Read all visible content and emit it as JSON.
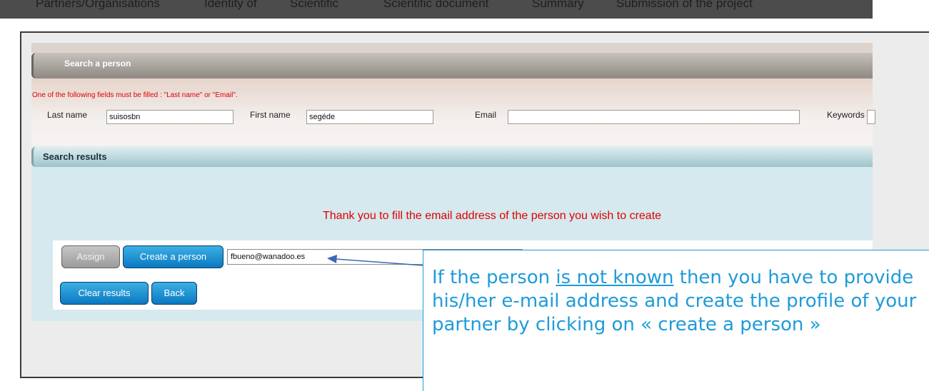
{
  "top_nav": {
    "tabs": [
      "Partners/Organisations",
      "Identity of",
      "Scientific",
      "Scientific document",
      "Summary",
      "Submission of the project"
    ]
  },
  "search_panel": {
    "header": "Search a person",
    "warning": "One of the following fields must be filled : \"Last name\" or \"Email\".",
    "last_name_label": "Last name",
    "last_name_value": "suisosbn",
    "first_name_label": "First name",
    "first_name_value": "segéde",
    "email_label": "Email",
    "email_value": "",
    "keywords_label": "Keywords"
  },
  "results_panel": {
    "header": "Search results",
    "message": "Thank you to fill the email address of the person you wish to create",
    "assign_label": "Assign",
    "create_label": "Create a person",
    "email_value": "fbueno@wanadoo.es",
    "clear_label": "Clear results",
    "back_label": "Back"
  },
  "callout": {
    "text_before": "If the person ",
    "text_underlined": "is not known",
    "text_after": " then you have to provide his/her e-mail address and create the profile of your partner by clicking on « create a person »"
  },
  "colors": {
    "error_red": "#e00000",
    "button_blue": "#1786cc",
    "callout_blue": "#1f9bd8"
  }
}
